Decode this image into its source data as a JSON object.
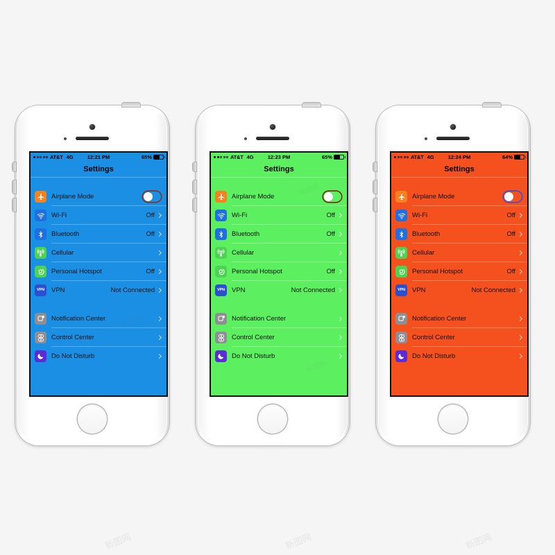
{
  "page": {
    "background": "#f5f5f5",
    "watermark_text": "新图网"
  },
  "phones": [
    {
      "id": "phone-blue",
      "screen_color": "#1a8fe3",
      "separator_color": "rgba(255,255,255,0.28)",
      "toggle_track_color": "#1a8fe3",
      "toggle_border_color": "#8c2f1a",
      "status": {
        "signal_filled": 1,
        "signal_total": 5,
        "carrier": "AT&T",
        "network": "4G",
        "time": "12:21 PM",
        "battery_percent": "65%",
        "battery_level": 65
      },
      "nav_title": "Settings"
    },
    {
      "id": "phone-green",
      "screen_color": "#5cf060",
      "separator_color": "rgba(255,255,255,0.35)",
      "toggle_track_color": "#5cf060",
      "toggle_border_color": "#7a2a15",
      "status": {
        "signal_filled": 2,
        "signal_total": 5,
        "carrier": "AT&T",
        "network": "4G",
        "time": "12:23 PM",
        "battery_percent": "65%",
        "battery_level": 65
      },
      "nav_title": "Settings"
    },
    {
      "id": "phone-orange",
      "screen_color": "#f4511e",
      "separator_color": "rgba(255,255,255,0.30)",
      "toggle_track_color": "#f4511e",
      "toggle_border_color": "#3b4fd8",
      "status": {
        "signal_filled": 1,
        "signal_total": 5,
        "carrier": "AT&T",
        "network": "4G",
        "time": "12:24 PM",
        "battery_percent": "64%",
        "battery_level": 64
      },
      "nav_title": "Settings"
    }
  ],
  "settings": {
    "group1": [
      {
        "key": "airplane-mode",
        "label": "Airplane Mode",
        "icon": "airplane-icon",
        "icon_color": "#f5821f",
        "control": "toggle",
        "toggle_on": false,
        "value": ""
      },
      {
        "key": "wifi",
        "label": "Wi-Fi",
        "icon": "wifi-icon",
        "icon_color": "#1f6fe0",
        "control": "chevron",
        "value": "Off"
      },
      {
        "key": "bluetooth",
        "label": "Bluetooth",
        "icon": "bluetooth-icon",
        "icon_color": "#1f6fe0",
        "control": "chevron",
        "value": "Off"
      },
      {
        "key": "cellular",
        "label": "Cellular",
        "icon": "cellular-icon",
        "icon_color": "#4cd352",
        "control": "chevron",
        "value": ""
      },
      {
        "key": "personal-hotspot",
        "label": "Personal Hotspot",
        "icon": "hotspot-icon",
        "icon_color": "#4cd352",
        "control": "chevron",
        "value": "Off"
      },
      {
        "key": "vpn",
        "label": "VPN",
        "icon": "vpn-icon",
        "icon_color": "#2a4fd0",
        "icon_text": "VPN",
        "control": "chevron",
        "value": "Not Connected"
      }
    ],
    "group2": [
      {
        "key": "notification-center",
        "label": "Notification Center",
        "icon": "notification-center-icon",
        "icon_color": "#8e8e93",
        "control": "chevron",
        "value": ""
      },
      {
        "key": "control-center",
        "label": "Control Center",
        "icon": "control-center-icon",
        "icon_color": "#8e8e93",
        "control": "chevron",
        "value": ""
      },
      {
        "key": "do-not-disturb",
        "label": "Do Not Disturb",
        "icon": "moon-icon",
        "icon_color": "#5b2cd6",
        "control": "chevron",
        "value": ""
      }
    ]
  }
}
